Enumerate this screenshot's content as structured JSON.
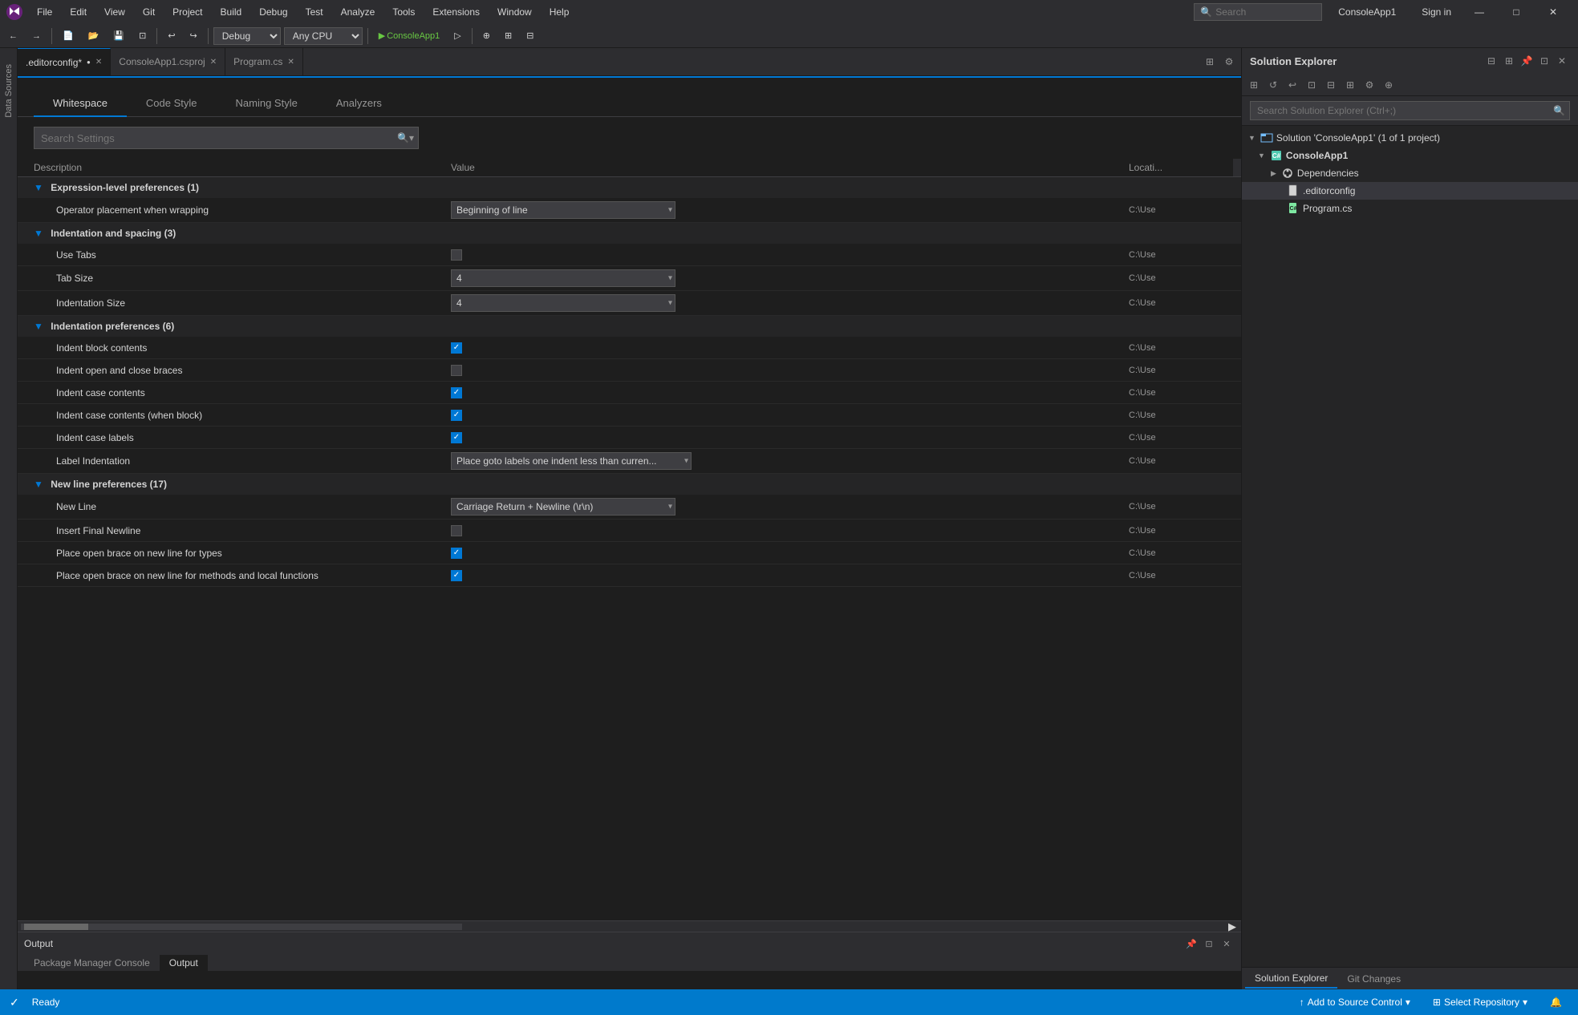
{
  "titlebar": {
    "logo": "VS",
    "menu": [
      "File",
      "Edit",
      "View",
      "Git",
      "Project",
      "Build",
      "Debug",
      "Test",
      "Analyze",
      "Tools",
      "Extensions",
      "Window",
      "Help"
    ],
    "search_placeholder": "Search",
    "app_title": "ConsoleApp1",
    "sign_in": "Sign in",
    "win_min": "—",
    "win_max": "□",
    "win_close": "✕"
  },
  "toolbar": {
    "back": "←",
    "forward": "→",
    "undo": "↩",
    "redo": "↪",
    "build_config": "Debug",
    "platform": "Any CPU",
    "run": "▶",
    "run_label": "ConsoleApp1"
  },
  "sidebar_left": {
    "label": "Data Sources"
  },
  "tabs": [
    {
      "label": ".editorconfig*",
      "modified": true,
      "active": true
    },
    {
      "label": "ConsoleApp1.csproj",
      "modified": false,
      "active": false
    },
    {
      "label": "Program.cs",
      "modified": false,
      "active": false
    }
  ],
  "category_tabs": [
    "Whitespace",
    "Code Style",
    "Naming Style",
    "Analyzers"
  ],
  "active_category": "Whitespace",
  "search_settings": {
    "placeholder": "Search Settings",
    "value": ""
  },
  "table_headers": {
    "description": "Description",
    "value": "Value",
    "location": "Locati..."
  },
  "sections": [
    {
      "name": "expression_level",
      "label": "Expression-level preferences (1)",
      "collapsed": false,
      "settings": [
        {
          "description": "Operator placement when wrapping",
          "type": "select",
          "value": "Beginning of line",
          "location": "C:\\Use"
        }
      ]
    },
    {
      "name": "indentation_spacing",
      "label": "Indentation and spacing (3)",
      "collapsed": false,
      "settings": [
        {
          "description": "Use Tabs",
          "type": "checkbox",
          "checked": false,
          "location": "C:\\Use"
        },
        {
          "description": "Tab Size",
          "type": "select",
          "value": "4",
          "location": "C:\\Use"
        },
        {
          "description": "Indentation Size",
          "type": "select",
          "value": "4",
          "location": "C:\\Use"
        }
      ]
    },
    {
      "name": "indentation_preferences",
      "label": "Indentation preferences (6)",
      "collapsed": false,
      "settings": [
        {
          "description": "Indent block contents",
          "type": "checkbox",
          "checked": true,
          "location": "C:\\Use"
        },
        {
          "description": "Indent open and close braces",
          "type": "checkbox",
          "checked": false,
          "location": "C:\\Use"
        },
        {
          "description": "Indent case contents",
          "type": "checkbox",
          "checked": true,
          "location": "C:\\Use"
        },
        {
          "description": "Indent case contents (when block)",
          "type": "checkbox",
          "checked": true,
          "location": "C:\\Use"
        },
        {
          "description": "Indent case labels",
          "type": "checkbox",
          "checked": true,
          "location": "C:\\Use"
        },
        {
          "description": "Label Indentation",
          "type": "select",
          "value": "Place goto labels one indent less than curren...",
          "location": "C:\\Use"
        }
      ]
    },
    {
      "name": "new_line_preferences",
      "label": "New line preferences (17)",
      "collapsed": false,
      "settings": [
        {
          "description": "New Line",
          "type": "select",
          "value": "Carriage Return + Newline (\\r\\n)",
          "location": "C:\\Use"
        },
        {
          "description": "Insert Final Newline",
          "type": "checkbox",
          "checked": false,
          "location": "C:\\Use"
        },
        {
          "description": "Place open brace on new line for types",
          "type": "checkbox",
          "checked": true,
          "location": "C:\\Use"
        },
        {
          "description": "Place open brace on new line for methods and local functions",
          "type": "checkbox",
          "checked": true,
          "location": "C:\\Use"
        }
      ]
    }
  ],
  "output_pane": {
    "title": "Output",
    "tabs": [
      "Package Manager Console",
      "Output"
    ]
  },
  "solution_explorer": {
    "title": "Solution Explorer",
    "search_placeholder": "Search Solution Explorer (Ctrl+;)",
    "tree": [
      {
        "level": 0,
        "label": "Solution 'ConsoleApp1' (1 of 1 project)",
        "icon": "solution",
        "expanded": true
      },
      {
        "level": 1,
        "label": "ConsoleApp1",
        "icon": "project",
        "expanded": true,
        "bold": true
      },
      {
        "level": 2,
        "label": "Dependencies",
        "icon": "dependencies",
        "expanded": false
      },
      {
        "level": 2,
        "label": ".editorconfig",
        "icon": "file",
        "selected": true
      },
      {
        "level": 2,
        "label": "Program.cs",
        "icon": "csharp"
      }
    ],
    "bottom_tabs": [
      "Solution Explorer",
      "Git Changes"
    ]
  },
  "status_bar": {
    "ready": "Ready",
    "add_source_control": "Add to Source Control",
    "select_repository": "Select Repository",
    "notification_icon": "🔔"
  }
}
